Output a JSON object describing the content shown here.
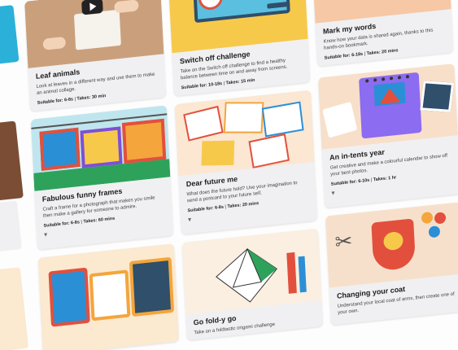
{
  "cards": [
    {
      "title": "Leaf animals",
      "desc": "Look at leaves in a different way and use them to make an animal collage.",
      "suitable": "Suitable for: 6-8s",
      "takes": "Takes: 30 min",
      "colors": {
        "bg": "#caa07c"
      }
    },
    {
      "title": "Switch off challenge",
      "desc": "Take on the Switch off challenge to find a healthy balance between time on and away from screens.",
      "suitable": "Suitable for: 10-18s",
      "takes": "Takes: 15 min",
      "colors": {
        "bg": "#f7c94b"
      }
    },
    {
      "title": "Mark my words",
      "desc": "Know how your data is shared again, thanks to this hands-on bookmark.",
      "suitable": "Suitable for: 6-18s",
      "takes": "Takes: 20 mins",
      "colors": {
        "bg": "#f6c8a6"
      }
    },
    {
      "title": "Fabulous funny frames",
      "desc": "Craft a frame for a photograph that makes you smile then make a gallery for someone to admire.",
      "suitable": "Suitable for: 6-8s",
      "takes": "Takes: 60 mins",
      "colors": {
        "bg": "#bfe6ef"
      }
    },
    {
      "title": "Dear future me",
      "desc": "What does the future hold? Use your imagination to send a postcard to your future self.",
      "suitable": "Suitable for: 6-8s",
      "takes": "Takes: 20 mins",
      "colors": {
        "bg": "#fbe7d2"
      }
    },
    {
      "title": "An in-tents year",
      "desc": "Get creative and make a colourful calendar to show off your best photos.",
      "suitable": "Suitable for: 6-10s",
      "takes": "Takes: 1 hr",
      "colors": {
        "bg": "#f8dfc9"
      }
    },
    {
      "title": "",
      "desc": "",
      "suitable": "",
      "takes": "",
      "colors": {
        "bg": "#fbe9d0"
      }
    },
    {
      "title": "Go fold-y go",
      "desc": "Take on a foldtastic origami challenge",
      "suitable": "",
      "takes": "",
      "colors": {
        "bg": "#fbefe1"
      }
    },
    {
      "title": "Changing your coat",
      "desc": "Understand your local coat of arms, then create one of your own.",
      "suitable": "",
      "takes": "",
      "colors": {
        "bg": "#f7e0cb"
      }
    }
  ],
  "icons": [
    "play-icon",
    "clock-icon",
    "chevron-down-icon",
    "calendar-icon",
    "scissors-icon"
  ]
}
